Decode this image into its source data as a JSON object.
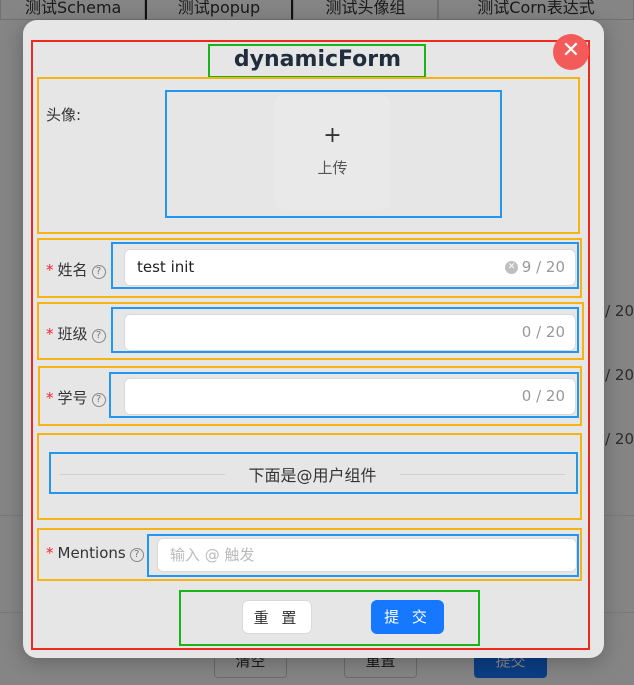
{
  "background": {
    "tabs": [
      "测试Schema",
      "测试popup",
      "测试头像组",
      "测试Corn表达式"
    ],
    "counts": [
      "/ 20",
      "/ 20",
      "/ 20"
    ],
    "buttons": {
      "clear": "清空",
      "reset": "重置",
      "submit": "提交"
    }
  },
  "modal": {
    "title": "dynamicForm",
    "close_icon": "close-icon",
    "avatar": {
      "label": "头像:",
      "upload_text": "上传",
      "plus_icon": "plus-icon"
    },
    "fields": {
      "name": {
        "label": "姓名",
        "value": "test init",
        "count": "9 / 20"
      },
      "class": {
        "label": "班级",
        "value": "",
        "count": "0 / 20"
      },
      "student_id": {
        "label": "学号",
        "value": "",
        "count": "0 / 20"
      },
      "mentions": {
        "label": "Mentions",
        "placeholder": "输入 @ 触发"
      }
    },
    "divider_text": "下面是@用户组件",
    "buttons": {
      "reset": "重 置",
      "submit": "提 交"
    }
  },
  "colors": {
    "primary": "#1677ff",
    "required": "#f5222d",
    "close": "#f35b5b"
  }
}
